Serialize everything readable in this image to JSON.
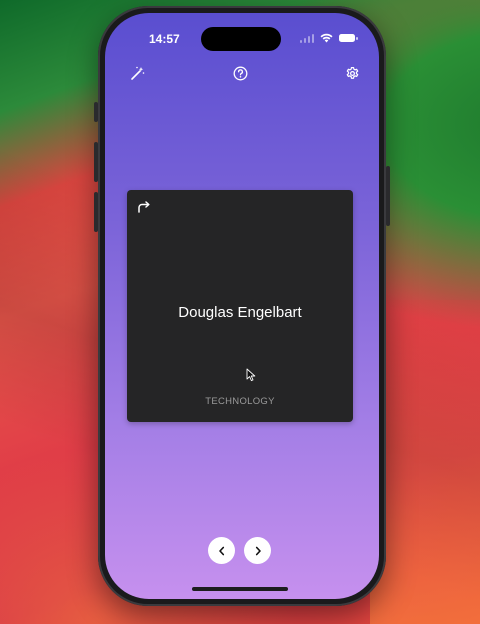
{
  "status_bar": {
    "time": "14:57"
  },
  "toolbar": {
    "left_icon": "magic-wand-icon",
    "center_icon": "help-icon",
    "right_icon": "gear-icon"
  },
  "card": {
    "flip_icon": "flip-arrow-icon",
    "title": "Douglas Engelbart",
    "category": "TECHNOLOGY"
  },
  "navigation": {
    "prev_icon": "chevron-left-icon",
    "next_icon": "chevron-right-icon"
  },
  "colors": {
    "background_top": "#5a4ed0",
    "background_bottom": "#c690ee",
    "card": "#252526",
    "category_text": "#9a9a9a"
  }
}
